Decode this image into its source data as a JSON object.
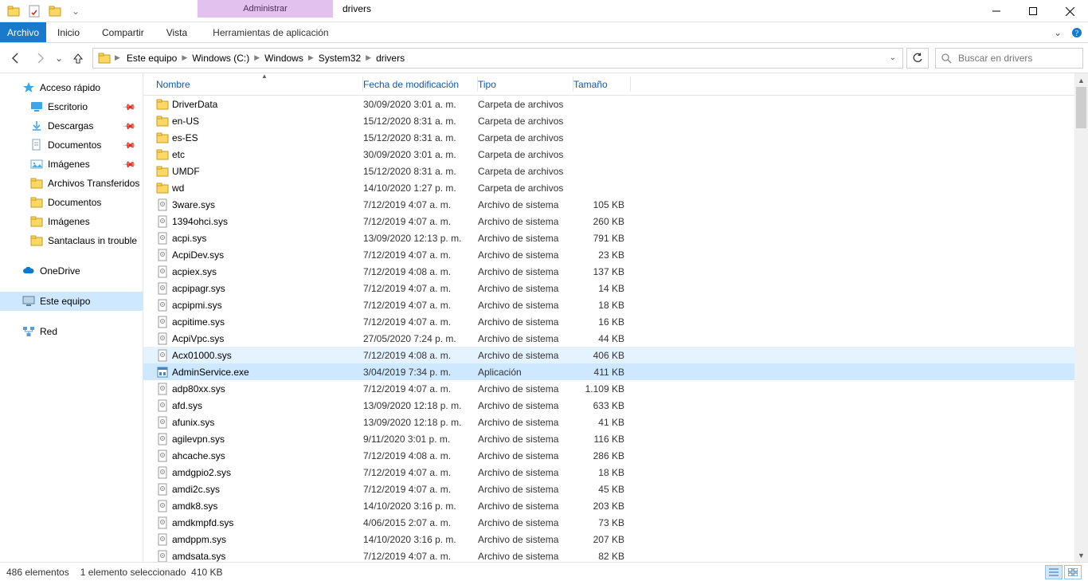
{
  "window": {
    "title": "drivers",
    "contextual_tab": "Administrar"
  },
  "ribbon": {
    "file": "Archivo",
    "tabs": [
      "Inicio",
      "Compartir",
      "Vista"
    ],
    "app_tools": "Herramientas de aplicación"
  },
  "breadcrumbs": [
    "Este equipo",
    "Windows (C:)",
    "Windows",
    "System32",
    "drivers"
  ],
  "search": {
    "placeholder": "Buscar en drivers"
  },
  "columns": {
    "name": "Nombre",
    "date": "Fecha de modificación",
    "type": "Tipo",
    "size": "Tamaño"
  },
  "sidebar": {
    "quick_access": "Acceso rápido",
    "quick_items": [
      {
        "label": "Escritorio",
        "icon": "desktop",
        "pin": true
      },
      {
        "label": "Descargas",
        "icon": "downloads",
        "pin": true
      },
      {
        "label": "Documentos",
        "icon": "documents",
        "pin": true
      },
      {
        "label": "Imágenes",
        "icon": "pictures",
        "pin": true
      },
      {
        "label": "Archivos Transferidos",
        "icon": "folder",
        "pin": false
      },
      {
        "label": "Documentos",
        "icon": "folder",
        "pin": false
      },
      {
        "label": "Imágenes",
        "icon": "folder",
        "pin": false
      },
      {
        "label": "Santaclaus in trouble",
        "icon": "folder",
        "pin": false
      }
    ],
    "onedrive": "OneDrive",
    "this_pc": "Este equipo",
    "network": "Red"
  },
  "files": [
    {
      "name": "DriverData",
      "date": "30/09/2020 3:01 a. m.",
      "type": "Carpeta de archivos",
      "size": "",
      "icon": "folder"
    },
    {
      "name": "en-US",
      "date": "15/12/2020 8:31 a. m.",
      "type": "Carpeta de archivos",
      "size": "",
      "icon": "folder"
    },
    {
      "name": "es-ES",
      "date": "15/12/2020 8:31 a. m.",
      "type": "Carpeta de archivos",
      "size": "",
      "icon": "folder"
    },
    {
      "name": "etc",
      "date": "30/09/2020 3:01 a. m.",
      "type": "Carpeta de archivos",
      "size": "",
      "icon": "folder"
    },
    {
      "name": "UMDF",
      "date": "15/12/2020 8:31 a. m.",
      "type": "Carpeta de archivos",
      "size": "",
      "icon": "folder"
    },
    {
      "name": "wd",
      "date": "14/10/2020 1:27 p. m.",
      "type": "Carpeta de archivos",
      "size": "",
      "icon": "folder"
    },
    {
      "name": "3ware.sys",
      "date": "7/12/2019 4:07 a. m.",
      "type": "Archivo de sistema",
      "size": "105 KB",
      "icon": "sys"
    },
    {
      "name": "1394ohci.sys",
      "date": "7/12/2019 4:07 a. m.",
      "type": "Archivo de sistema",
      "size": "260 KB",
      "icon": "sys"
    },
    {
      "name": "acpi.sys",
      "date": "13/09/2020 12:13 p. m.",
      "type": "Archivo de sistema",
      "size": "791 KB",
      "icon": "sys"
    },
    {
      "name": "AcpiDev.sys",
      "date": "7/12/2019 4:07 a. m.",
      "type": "Archivo de sistema",
      "size": "23 KB",
      "icon": "sys"
    },
    {
      "name": "acpiex.sys",
      "date": "7/12/2019 4:08 a. m.",
      "type": "Archivo de sistema",
      "size": "137 KB",
      "icon": "sys"
    },
    {
      "name": "acpipagr.sys",
      "date": "7/12/2019 4:07 a. m.",
      "type": "Archivo de sistema",
      "size": "14 KB",
      "icon": "sys"
    },
    {
      "name": "acpipmi.sys",
      "date": "7/12/2019 4:07 a. m.",
      "type": "Archivo de sistema",
      "size": "18 KB",
      "icon": "sys"
    },
    {
      "name": "acpitime.sys",
      "date": "7/12/2019 4:07 a. m.",
      "type": "Archivo de sistema",
      "size": "16 KB",
      "icon": "sys"
    },
    {
      "name": "AcpiVpc.sys",
      "date": "27/05/2020 7:24 p. m.",
      "type": "Archivo de sistema",
      "size": "44 KB",
      "icon": "sys"
    },
    {
      "name": "Acx01000.sys",
      "date": "7/12/2019 4:08 a. m.",
      "type": "Archivo de sistema",
      "size": "406 KB",
      "icon": "sys",
      "state": "hover"
    },
    {
      "name": "AdminService.exe",
      "date": "3/04/2019 7:34 p. m.",
      "type": "Aplicación",
      "size": "411 KB",
      "icon": "exe",
      "state": "selected"
    },
    {
      "name": "adp80xx.sys",
      "date": "7/12/2019 4:07 a. m.",
      "type": "Archivo de sistema",
      "size": "1.109 KB",
      "icon": "sys"
    },
    {
      "name": "afd.sys",
      "date": "13/09/2020 12:18 p. m.",
      "type": "Archivo de sistema",
      "size": "633 KB",
      "icon": "sys"
    },
    {
      "name": "afunix.sys",
      "date": "13/09/2020 12:18 p. m.",
      "type": "Archivo de sistema",
      "size": "41 KB",
      "icon": "sys"
    },
    {
      "name": "agilevpn.sys",
      "date": "9/11/2020 3:01 p. m.",
      "type": "Archivo de sistema",
      "size": "116 KB",
      "icon": "sys"
    },
    {
      "name": "ahcache.sys",
      "date": "7/12/2019 4:08 a. m.",
      "type": "Archivo de sistema",
      "size": "286 KB",
      "icon": "sys"
    },
    {
      "name": "amdgpio2.sys",
      "date": "7/12/2019 4:07 a. m.",
      "type": "Archivo de sistema",
      "size": "18 KB",
      "icon": "sys"
    },
    {
      "name": "amdi2c.sys",
      "date": "7/12/2019 4:07 a. m.",
      "type": "Archivo de sistema",
      "size": "45 KB",
      "icon": "sys"
    },
    {
      "name": "amdk8.sys",
      "date": "14/10/2020 3:16 p. m.",
      "type": "Archivo de sistema",
      "size": "203 KB",
      "icon": "sys"
    },
    {
      "name": "amdkmpfd.sys",
      "date": "4/06/2015 2:07 a. m.",
      "type": "Archivo de sistema",
      "size": "73 KB",
      "icon": "sys"
    },
    {
      "name": "amdppm.sys",
      "date": "14/10/2020 3:16 p. m.",
      "type": "Archivo de sistema",
      "size": "207 KB",
      "icon": "sys"
    },
    {
      "name": "amdsata.sys",
      "date": "7/12/2019 4:07 a. m.",
      "type": "Archivo de sistema",
      "size": "82 KB",
      "icon": "sys"
    }
  ],
  "status": {
    "count": "486 elementos",
    "selection": "1 elemento seleccionado",
    "sel_size": "410 KB"
  }
}
